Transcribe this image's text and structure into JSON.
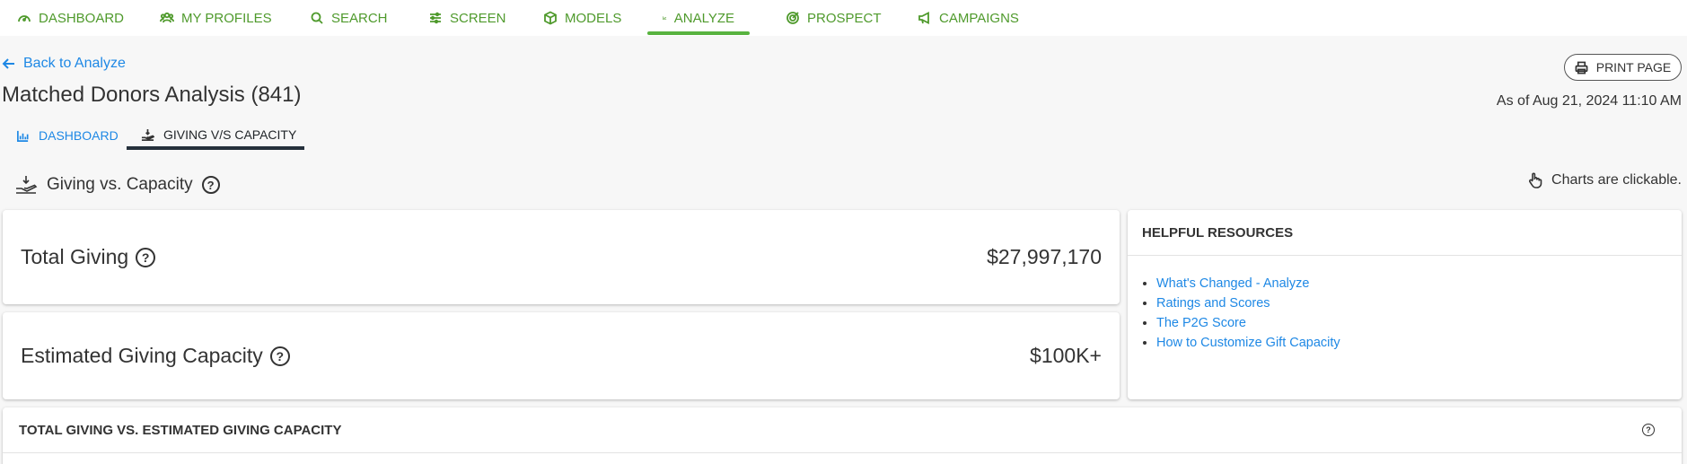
{
  "nav": {
    "items": [
      {
        "label": "DASHBOARD",
        "icon": "speedometer-icon"
      },
      {
        "label": "MY PROFILES",
        "icon": "people-icon"
      },
      {
        "label": "SEARCH",
        "icon": "search-icon"
      },
      {
        "label": "SCREEN",
        "icon": "sliders-icon"
      },
      {
        "label": "MODELS",
        "icon": "cube-icon"
      },
      {
        "label": "ANALYZE",
        "icon": "chart-line-icon"
      },
      {
        "label": "PROSPECT",
        "icon": "target-icon"
      },
      {
        "label": "CAMPAIGNS",
        "icon": "megaphone-icon"
      }
    ],
    "active": "ANALYZE",
    "accent_color": "#58b33f"
  },
  "back_link": "Back to Analyze",
  "page_title": "Matched Donors Analysis (841)",
  "print_button": "PRINT PAGE",
  "as_of": "As of Aug 21, 2024 11:10 AM",
  "tabs": [
    {
      "label": "DASHBOARD",
      "icon": "bar-chart-icon"
    },
    {
      "label": "GIVING V/S CAPACITY",
      "icon": "hand-coins-icon",
      "active": true
    }
  ],
  "section": {
    "title": "Giving vs. Capacity",
    "clickable_note": "Charts are clickable."
  },
  "metrics": {
    "total_giving": {
      "label": "Total Giving",
      "value": "$27,997,170"
    },
    "capacity": {
      "label": "Estimated Giving Capacity",
      "value": "$100K+"
    }
  },
  "resources": {
    "title": "HELPFUL RESOURCES",
    "links": [
      "What's Changed - Analyze",
      "Ratings and Scores",
      "The P2G Score",
      "How to Customize Gift Capacity"
    ]
  },
  "bottom_panel": {
    "title": "TOTAL GIVING VS. ESTIMATED GIVING CAPACITY"
  },
  "colors": {
    "link": "#1e88e5",
    "nav_text": "#4f9a2c"
  }
}
